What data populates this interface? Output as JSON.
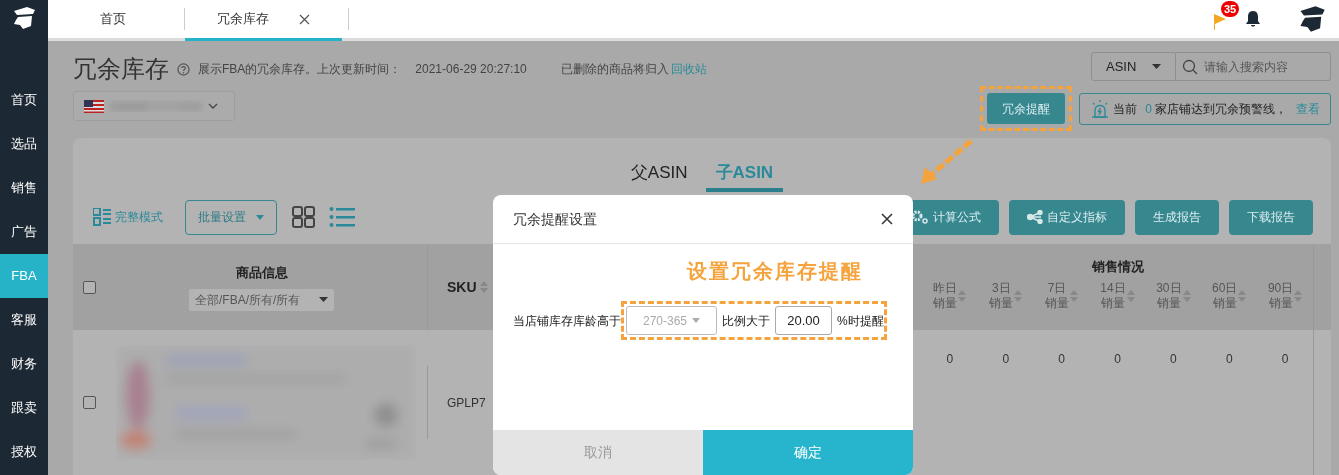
{
  "sidebar": {
    "items": [
      {
        "label": "首页",
        "selected": false
      },
      {
        "label": "选品",
        "selected": false
      },
      {
        "label": "销售",
        "selected": false
      },
      {
        "label": "广告",
        "selected": false
      },
      {
        "label": "FBA",
        "selected": true
      },
      {
        "label": "客服",
        "selected": false
      },
      {
        "label": "财务",
        "selected": false
      },
      {
        "label": "跟卖",
        "selected": false
      },
      {
        "label": "授权",
        "selected": false
      }
    ]
  },
  "top_tabs": [
    {
      "label": "首页",
      "selected": false,
      "closable": false
    },
    {
      "label": "冗余库存",
      "selected": true,
      "closable": true
    }
  ],
  "notifications": {
    "badge": "35"
  },
  "header": {
    "title": "冗余库存",
    "description": "展示FBA的冗余库存。上次更新时间：",
    "updated_at": "2021-06-29 20:27:10",
    "recycle_note": "已删除的商品将归入",
    "recycle_link": "回收站"
  },
  "search": {
    "field": "ASIN",
    "placeholder": "请输入搜索内容"
  },
  "reminder_button": "冗余提醒",
  "alert": {
    "prefix": "当前",
    "count": "0",
    "text": "家店铺达到冗余预警线，",
    "link": "查看"
  },
  "asin_tabs": [
    {
      "label": "父ASIN",
      "selected": false
    },
    {
      "label": "子ASIN",
      "selected": true
    }
  ],
  "toolbar": {
    "mode": "完整模式",
    "batch": "批量设置",
    "view_modes": [
      {
        "kind": "grid",
        "selected": false
      },
      {
        "kind": "list",
        "selected": true
      }
    ],
    "actions": [
      {
        "label": "计算公式",
        "kind": "gear"
      },
      {
        "label": "自定义指标",
        "kind": "share"
      },
      {
        "label": "生成报告",
        "kind": "plain"
      },
      {
        "label": "下载报告",
        "kind": "plain"
      }
    ]
  },
  "table": {
    "all_checked": false,
    "product_column": "商品信息",
    "product_filter": "全部/FBA/所有/所有",
    "sku_column": "SKU",
    "sales_group": "销售情况",
    "sales_columns": [
      {
        "lines": [
          "昨日",
          "销量"
        ]
      },
      {
        "lines": [
          "3日",
          "销量"
        ]
      },
      {
        "lines": [
          "7日",
          "销量"
        ]
      },
      {
        "lines": [
          "14日",
          "销量"
        ]
      },
      {
        "lines": [
          "30日",
          "销量"
        ]
      },
      {
        "lines": [
          "60日",
          "销量"
        ]
      },
      {
        "lines": [
          "90日",
          "销量"
        ]
      }
    ],
    "rows": [
      {
        "checked": false,
        "sku": "GPLP7",
        "sales": [
          "0",
          "0",
          "0",
          "0",
          "0",
          "0",
          "0"
        ]
      }
    ]
  },
  "modal": {
    "title": "冗余提醒设置",
    "annotation": "设置冗余库存提醒",
    "label": "当店铺库存库龄高于",
    "age_select": {
      "value": "270-365",
      "disabled": true
    },
    "ratio_label": "比例大于",
    "ratio": "20.00",
    "suffix": "%时提醒",
    "cancel": "取消",
    "confirm": "确定"
  }
}
